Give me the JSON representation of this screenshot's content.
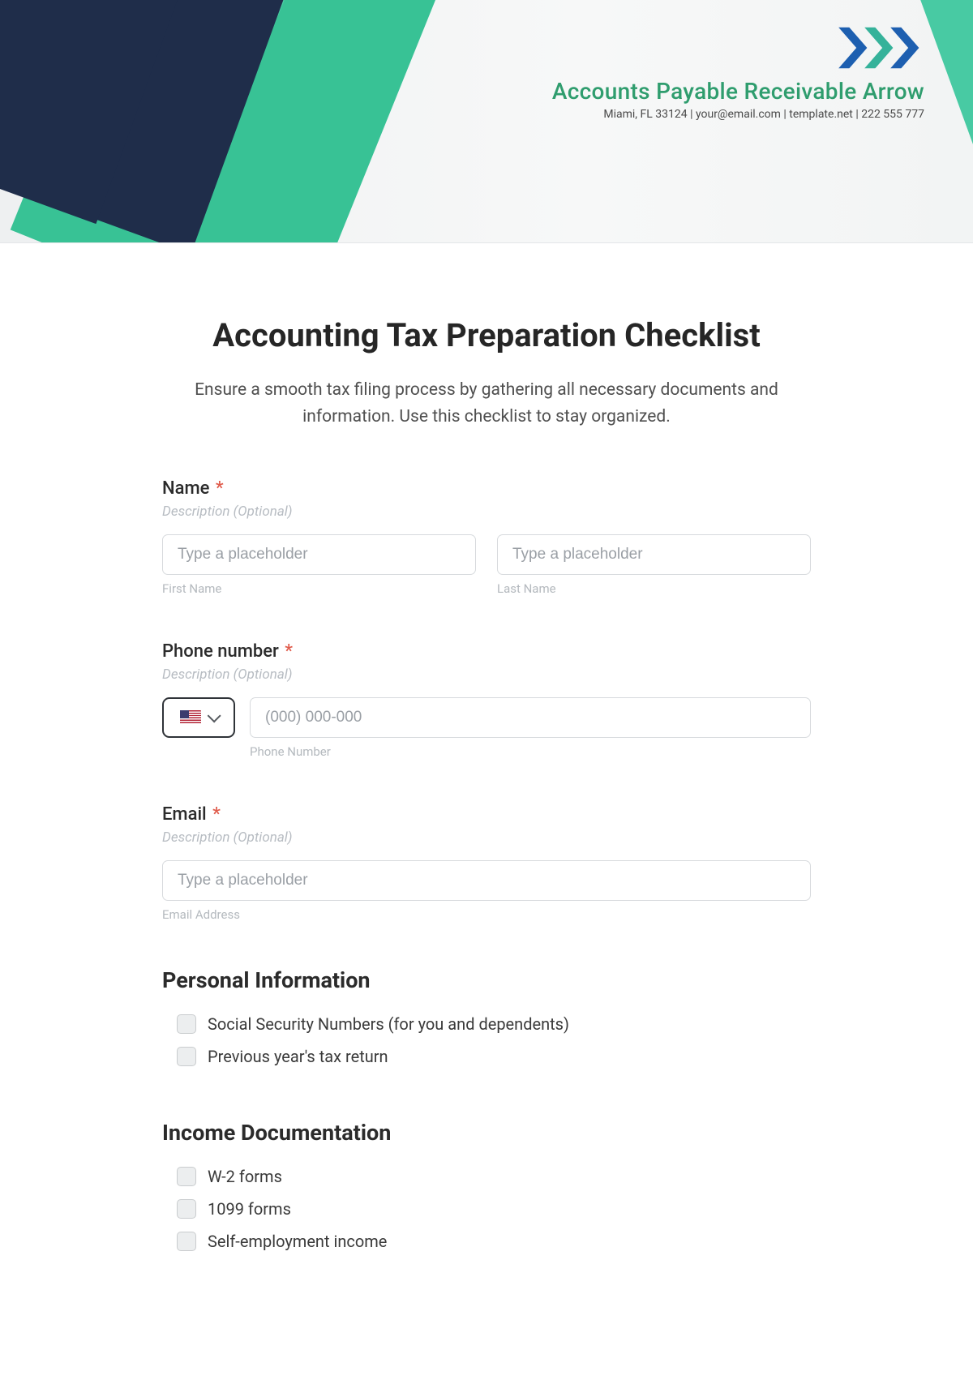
{
  "brand": {
    "title": "Accounts Payable Receivable Arrow",
    "subline": "Miami, FL 33124 | your@email.com | template.net | 222 555 777"
  },
  "page": {
    "title": "Accounting Tax Preparation Checklist",
    "intro": "Ensure a smooth tax filing process by gathering all necessary documents and information. Use this checklist to stay organized."
  },
  "fields": {
    "name": {
      "label": "Name",
      "required_mark": "*",
      "desc": "Description (Optional)",
      "first_placeholder": "Type a placeholder",
      "last_placeholder": "Type a placeholder",
      "first_sub": "First Name",
      "last_sub": "Last Name"
    },
    "phone": {
      "label": "Phone number",
      "required_mark": "*",
      "desc": "Description (Optional)",
      "placeholder": "(000) 000-000",
      "sub": "Phone Number"
    },
    "email": {
      "label": "Email",
      "required_mark": "*",
      "desc": "Description (Optional)",
      "placeholder": "Type a placeholder",
      "sub": "Email Address"
    }
  },
  "sections": {
    "personal": {
      "title": "Personal Information",
      "items": [
        "Social Security Numbers (for you and dependents)",
        "Previous year's tax return"
      ]
    },
    "income": {
      "title": "Income Documentation",
      "items": [
        "W-2 forms",
        "1099 forms",
        "Self-employment income"
      ]
    }
  }
}
